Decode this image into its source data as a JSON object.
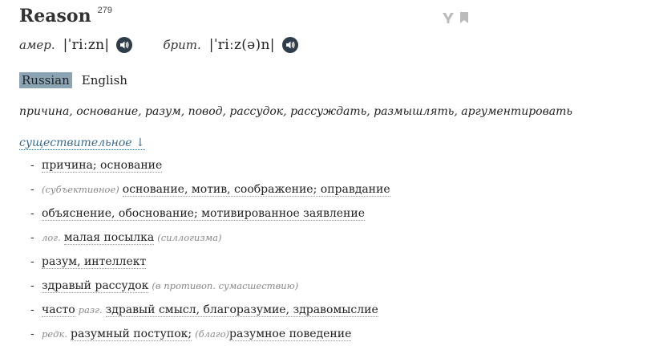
{
  "header": {
    "word": "Reason",
    "frequency": "279"
  },
  "pronunciation": {
    "us_label": "амер.",
    "us_ipa": "|ˈriːzn|",
    "uk_label": "брит.",
    "uk_ipa": "|ˈriːz(ə)n|"
  },
  "languages": {
    "active": "Russian",
    "inactive": "English"
  },
  "summary": "причина, основание, разум, повод, рассудок, рассуждать, размышлять, аргументировать",
  "part_of_speech": "существительное ↓",
  "senses": [
    {
      "pre_note": "",
      "pre_text": "",
      "text": "причина; основание",
      "post_note": "",
      "post_text": ""
    },
    {
      "pre_note": "(субъективное)",
      "pre_text": "",
      "text": "основание, мотив, соображение; оправдание",
      "post_note": "",
      "post_text": ""
    },
    {
      "pre_note": "",
      "pre_text": "",
      "text": "объяснение, обоснование; мотивированное заявление",
      "post_note": "",
      "post_text": ""
    },
    {
      "pre_note": "лог.",
      "pre_text": "",
      "text": "малая посылка",
      "post_note": "(силлогизма)",
      "post_text": ""
    },
    {
      "pre_note": "",
      "pre_text": "",
      "text": "разум, интеллект",
      "post_note": "",
      "post_text": ""
    },
    {
      "pre_note": "",
      "pre_text": "",
      "text": "здравый рассудок",
      "post_note": "(в противоп. сумасшествию)",
      "post_text": ""
    },
    {
      "pre_note": "",
      "pre_text": "часто",
      "mid_note": "разг.",
      "text": "здравый смысл, благоразумие, здравомыслие",
      "post_note": "",
      "post_text": ""
    },
    {
      "pre_note": "редк.",
      "pre_text": "",
      "text": "разумный поступок;",
      "post_note": "(благо)",
      "post_text": "разумное поведение"
    }
  ]
}
